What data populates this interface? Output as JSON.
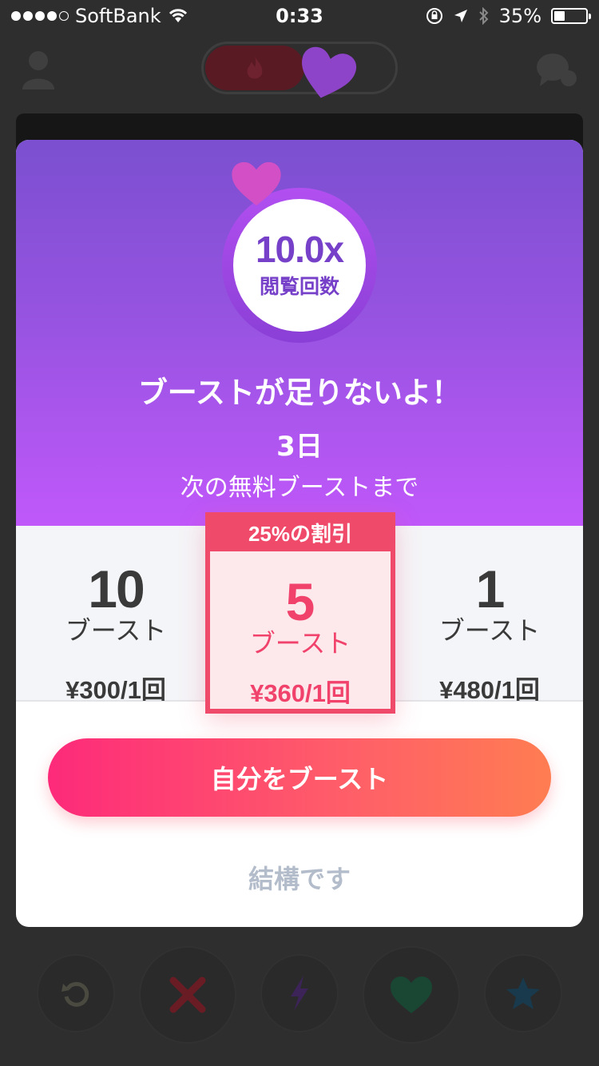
{
  "status_bar": {
    "carrier": "SoftBank",
    "time": "0:33",
    "battery": "35%"
  },
  "modal": {
    "multiplier": "10.0x",
    "multiplier_label": "閲覧回数",
    "title": "ブーストが足りないよ！",
    "days": "3日",
    "subtitle": "次の無料ブーストまで",
    "packages": [
      {
        "count": "10",
        "unit": "ブースト",
        "price": "¥300/1回"
      },
      {
        "badge": "25%の割引",
        "count": "5",
        "unit": "ブースト",
        "price": "¥360/1回"
      },
      {
        "count": "1",
        "unit": "ブースト",
        "price": "¥480/1回"
      }
    ],
    "cta_label": "自分をブースト",
    "dismiss_label": "結構です"
  },
  "colors": {
    "accent": "#f04a6a",
    "header_top": "#7b4fd0",
    "header_bottom": "#c058fa",
    "cta_start": "#fd2a7a",
    "cta_end": "#ff7d52"
  }
}
